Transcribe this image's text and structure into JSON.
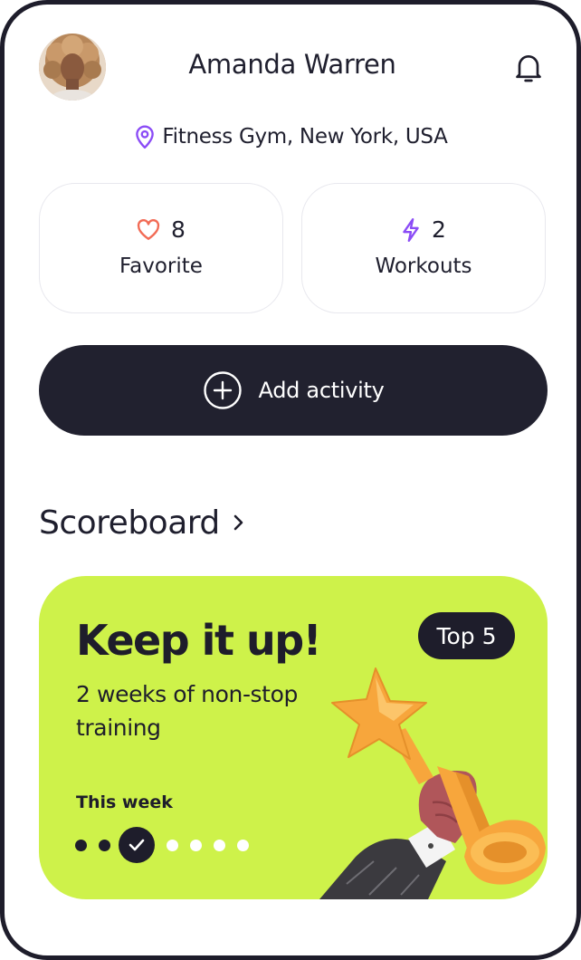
{
  "profile": {
    "name": "Amanda Warren",
    "location": "Fitness Gym, New York, USA"
  },
  "stats": [
    {
      "count": "8",
      "label": "Favorite",
      "icon": "heart-icon",
      "color": "#f26b55"
    },
    {
      "count": "2",
      "label": "Workouts",
      "icon": "lightning-icon",
      "color": "#8b4cf6"
    }
  ],
  "add_activity": {
    "label": "Add activity",
    "icon": "plus-circle-icon"
  },
  "scoreboard": {
    "heading": "Scoreboard",
    "card": {
      "title": "Keep it up!",
      "subtitle": "2 weeks of non-stop training",
      "badge": "Top 5",
      "week_label": "This week",
      "days": [
        "done",
        "done",
        "current",
        "todo",
        "todo",
        "todo",
        "todo"
      ],
      "background": "#cef24a"
    }
  },
  "colors": {
    "dark": "#1e1d2b",
    "accent_purple": "#8b4cf6",
    "accent_green": "#cef24a"
  }
}
